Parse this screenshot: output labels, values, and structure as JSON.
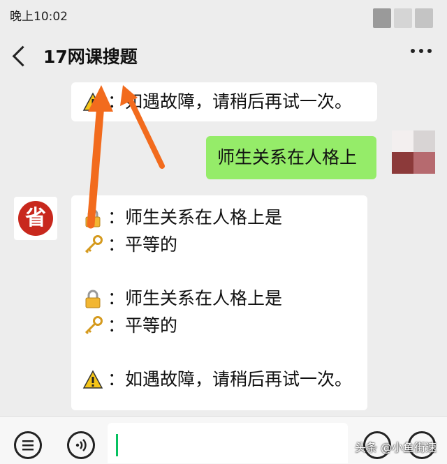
{
  "status_bar": {
    "time": "晚上10:02"
  },
  "header": {
    "title": "17网课搜题",
    "back_icon": "back-arrow-icon",
    "more_icon": "more-dots-icon"
  },
  "messages": {
    "top_partial": {
      "icon": "warning-icon",
      "text": "：如遇故障，请稍后再试一次。"
    },
    "user": {
      "text": "师生关系在人格上"
    },
    "reply": {
      "avatar_text": "省",
      "blocks": [
        {
          "question_icon": "lock-icon",
          "question": "：师生关系在人格上是",
          "answer_icon": "key-icon",
          "answer": "：平等的"
        },
        {
          "question_icon": "lock-icon",
          "question": "：师生关系在人格上是",
          "answer_icon": "key-icon",
          "answer": "：平等的"
        }
      ],
      "notice_icon": "warning-icon",
      "notice": "：如遇故障，请稍后再试一次。"
    }
  },
  "bottom_bar": {
    "input_value": "",
    "watermark": "头条 @小鱼街速"
  },
  "colors": {
    "background": "#ededed",
    "user_bubble": "#95ec69",
    "bot_bubble": "#ffffff",
    "annotation_arrow": "#f26b1d",
    "seal": "#c8281d"
  }
}
